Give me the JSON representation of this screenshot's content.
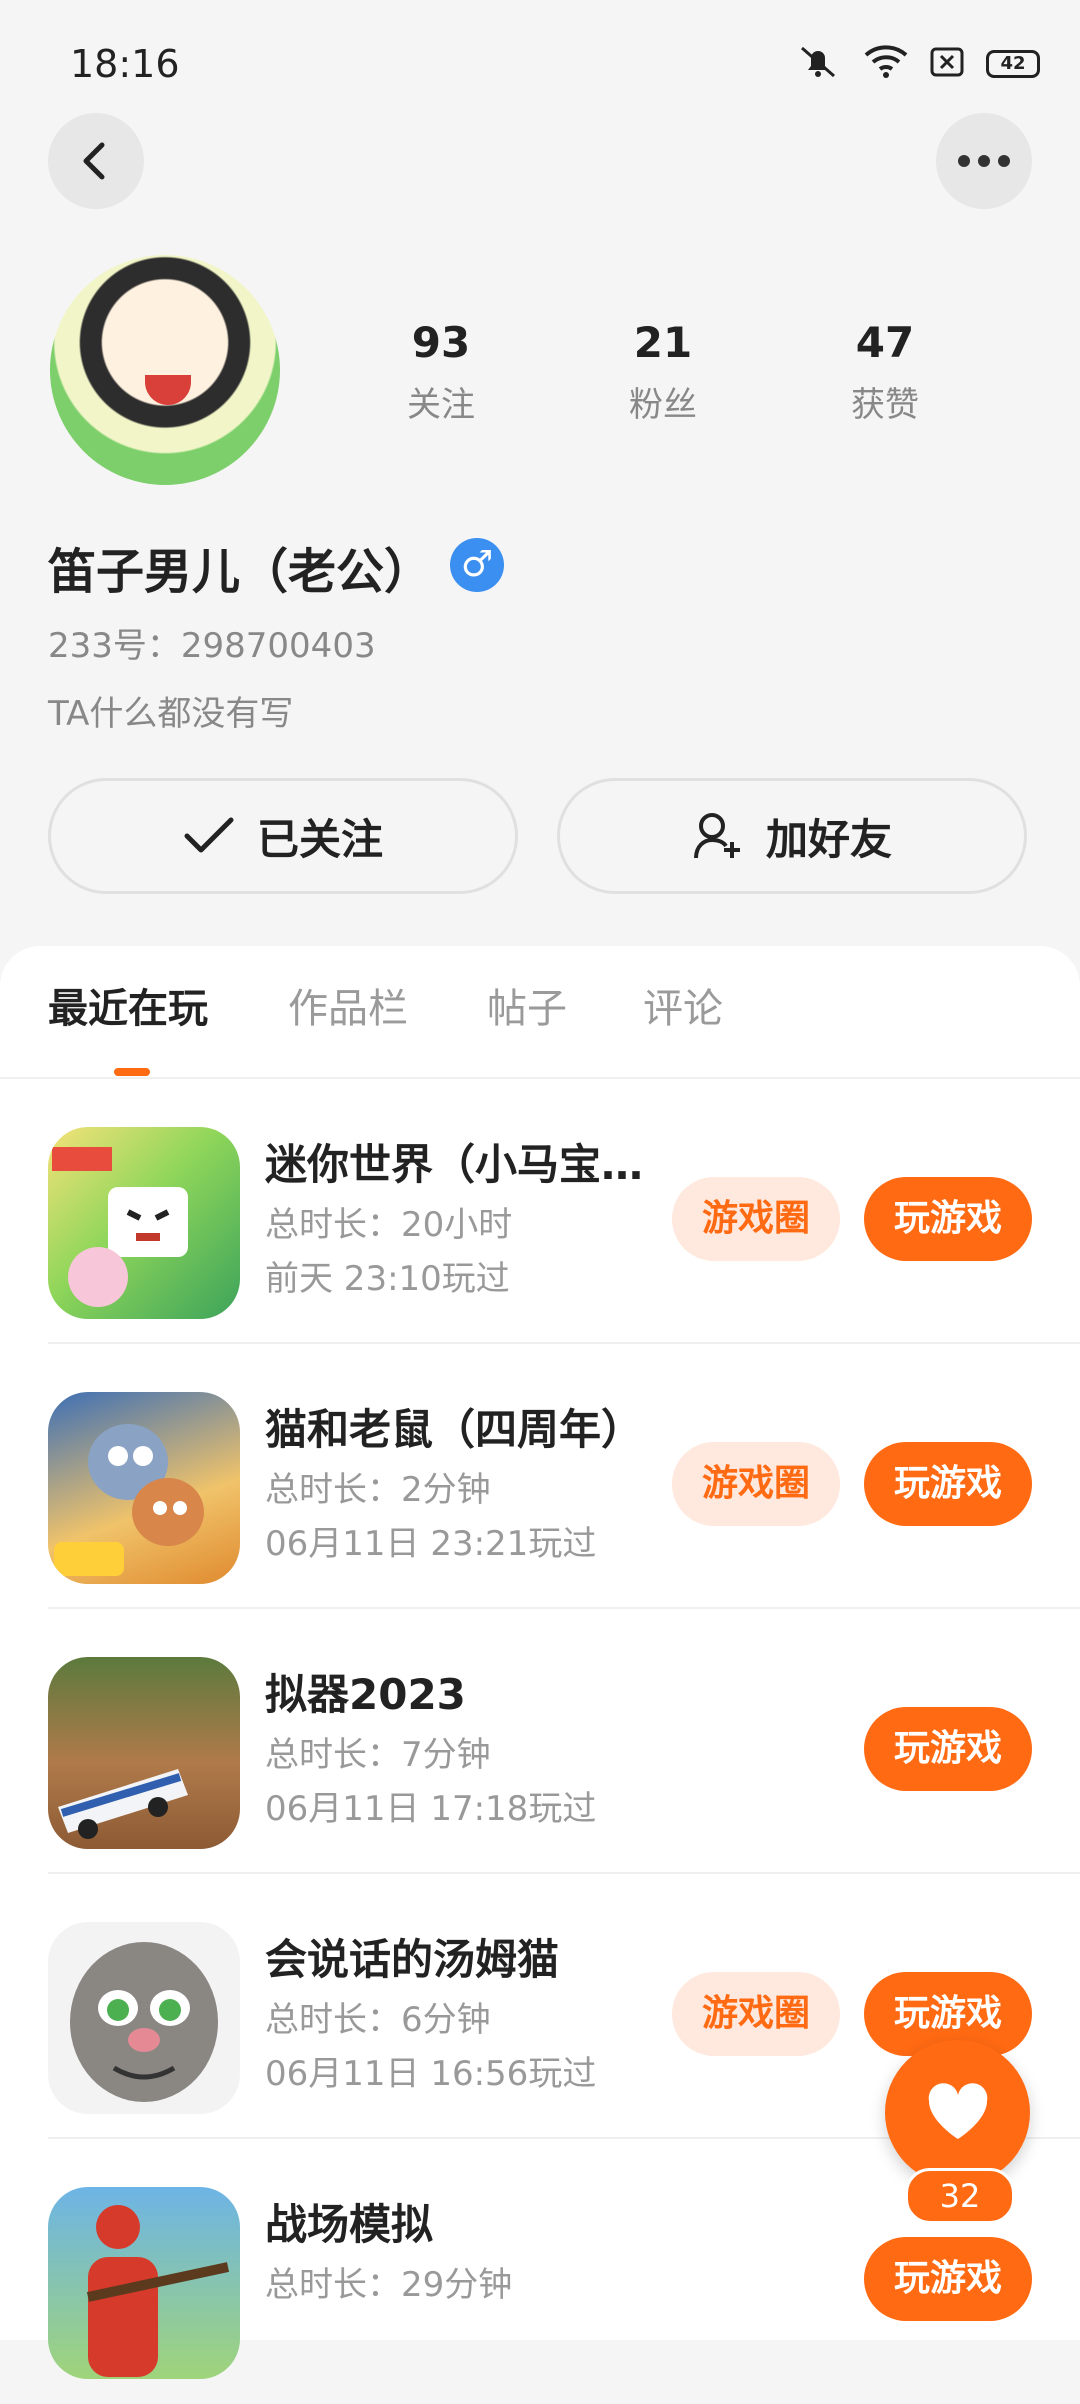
{
  "status_bar": {
    "time": "18:16",
    "battery": "42",
    "icons": [
      "mute-icon",
      "wifi-icon",
      "sim-off-icon",
      "battery-icon"
    ]
  },
  "profile": {
    "stats": [
      {
        "value": "93",
        "label": "关注"
      },
      {
        "value": "21",
        "label": "粉丝"
      },
      {
        "value": "47",
        "label": "获赞"
      }
    ],
    "name": "笛子男儿（老公）",
    "gender_symbol": "♂",
    "uid": "233号：298700403",
    "bio": "TA什么都没有写",
    "follow_label": "已关注",
    "add_friend_label": "加好友"
  },
  "tabs": [
    {
      "label": "最近在玩",
      "active": true
    },
    {
      "label": "作品栏",
      "active": false
    },
    {
      "label": "帖子",
      "active": false
    },
    {
      "label": "评论",
      "active": false
    }
  ],
  "games": [
    {
      "title": "迷你世界（小马宝…",
      "duration": "总时长：20小时",
      "last_played": "前天 23:10玩过",
      "circle": "游戏圈",
      "play": "玩游戏"
    },
    {
      "title": "猫和老鼠（四周年）",
      "duration": "总时长：2分钟",
      "last_played": "06月11日 23:21玩过",
      "circle": "游戏圈",
      "play": "玩游戏"
    },
    {
      "title": "拟器2023",
      "duration": "总时长：7分钟",
      "last_played": "06月11日 17:18玩过",
      "play": "玩游戏"
    },
    {
      "title": "会说话的汤姆猫",
      "duration": "总时长：6分钟",
      "last_played": "06月11日 16:56玩过",
      "circle": "游戏圈",
      "play": "玩游戏"
    },
    {
      "title": "战场模拟",
      "duration": "总时长：29分钟",
      "play": "玩游戏"
    }
  ],
  "like_fab": {
    "count": "32"
  },
  "colors": {
    "accent": "#ff6a13",
    "accent_light": "#ffe8dd",
    "gender_blue": "#3b8ff0"
  }
}
